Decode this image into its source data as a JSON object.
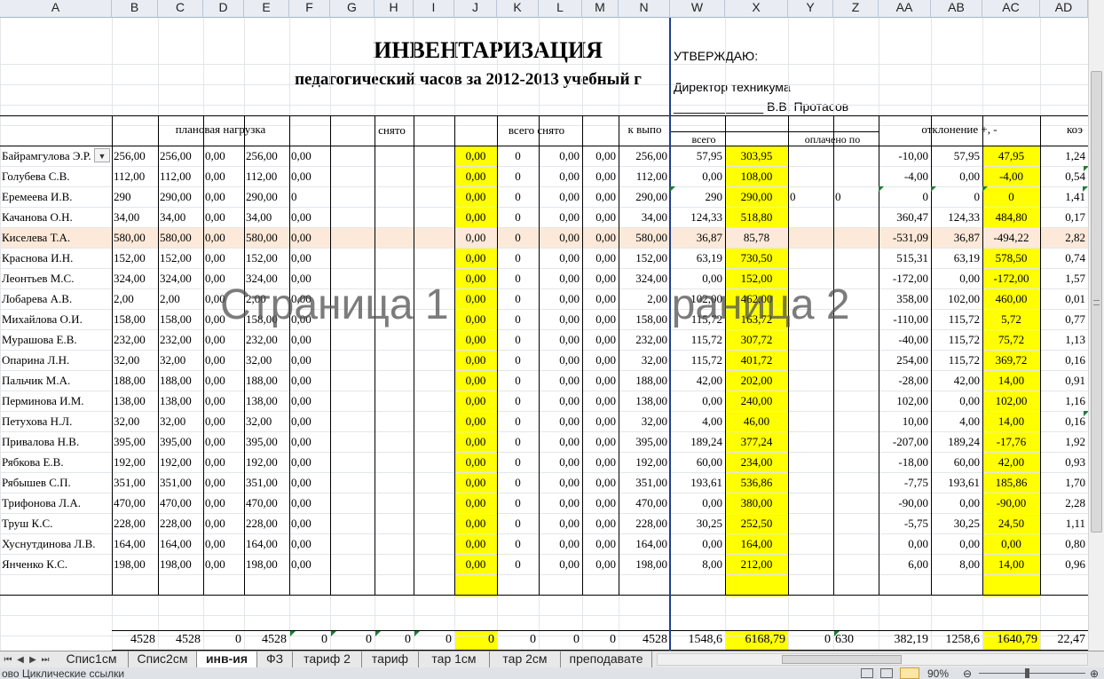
{
  "columns": [
    "A",
    "B",
    "C",
    "D",
    "E",
    "F",
    "G",
    "H",
    "I",
    "J",
    "K",
    "L",
    "M",
    "N",
    "W",
    "X",
    "Y",
    "Z",
    "AA",
    "AB",
    "AC",
    "AD"
  ],
  "title": "ИНВЕНТАРИЗАЦИЯ",
  "subtitle": "педагогический часов за 2012-2013 учебный г",
  "approval": {
    "approve": "УТВЕРЖДАЮ:",
    "director": "Директор техникума",
    "signature": "_____________ В.В. Протасов"
  },
  "headers": {
    "planned": "плановая нагрузка",
    "removed": "снято",
    "total_removed": "всего снято",
    "to_do": "к выпо",
    "total": "всего",
    "paid": "оплачено по",
    "deviation": "отклонение +, -",
    "coef": "коэ"
  },
  "rows": [
    [
      "Байрамгулова Э.Р.",
      "256,00",
      "256,00",
      "0,00",
      "256,00",
      "0,00",
      "0,00",
      "0",
      "0,00",
      "0,00",
      "256,00",
      "57,95",
      "303,95",
      "",
      "",
      "-10,00",
      "57,95",
      "47,95",
      "1,24"
    ],
    [
      "Голубева С.В.",
      "112,00",
      "112,00",
      "0,00",
      "112,00",
      "0,00",
      "0,00",
      "0",
      "0,00",
      "0,00",
      "112,00",
      "0,00",
      "108,00",
      "",
      "",
      "-4,00",
      "0,00",
      "-4,00",
      "0,54"
    ],
    [
      "Еремеева И.В.",
      "290",
      "290,00",
      "0,00",
      "290,00",
      "0",
      "0,00",
      "0",
      "0,00",
      "0,00",
      "290,00",
      "290",
      "290,00",
      "0",
      "0",
      "0",
      "0",
      "0",
      "1,41"
    ],
    [
      "Качанова О.Н.",
      "34,00",
      "34,00",
      "0,00",
      "34,00",
      "0,00",
      "0,00",
      "0",
      "0,00",
      "0,00",
      "34,00",
      "124,33",
      "518,80",
      "",
      "",
      "360,47",
      "124,33",
      "484,80",
      "0,17"
    ],
    [
      "Киселева Т.А.",
      "580,00",
      "580,00",
      "0,00",
      "580,00",
      "0,00",
      "0,00",
      "0",
      "0,00",
      "0,00",
      "580,00",
      "36,87",
      "85,78",
      "",
      "",
      "-531,09",
      "36,87",
      "-494,22",
      "2,82"
    ],
    [
      "Краснова И.Н.",
      "152,00",
      "152,00",
      "0,00",
      "152,00",
      "0,00",
      "0,00",
      "0",
      "0,00",
      "0,00",
      "152,00",
      "63,19",
      "730,50",
      "",
      "",
      "515,31",
      "63,19",
      "578,50",
      "0,74"
    ],
    [
      "Леонтьев М.С.",
      "324,00",
      "324,00",
      "0,00",
      "324,00",
      "0,00",
      "0,00",
      "0",
      "0,00",
      "0,00",
      "324,00",
      "0,00",
      "152,00",
      "",
      "",
      "-172,00",
      "0,00",
      "-172,00",
      "1,57"
    ],
    [
      "Лобарева А.В.",
      "2,00",
      "2,00",
      "0,00",
      "2,00",
      "0,00",
      "0,00",
      "0",
      "0,00",
      "0,00",
      "2,00",
      "102,00",
      "462,00",
      "",
      "",
      "358,00",
      "102,00",
      "460,00",
      "0,01"
    ],
    [
      "Михайлова О.И.",
      "158,00",
      "158,00",
      "0,00",
      "158,00",
      "0,00",
      "0,00",
      "0",
      "0,00",
      "0,00",
      "158,00",
      "115,72",
      "163,72",
      "",
      "",
      "-110,00",
      "115,72",
      "5,72",
      "0,77"
    ],
    [
      "Мурашова Е.В.",
      "232,00",
      "232,00",
      "0,00",
      "232,00",
      "0,00",
      "0,00",
      "0",
      "0,00",
      "0,00",
      "232,00",
      "115,72",
      "307,72",
      "",
      "",
      "-40,00",
      "115,72",
      "75,72",
      "1,13"
    ],
    [
      "Опарина Л.Н.",
      "32,00",
      "32,00",
      "0,00",
      "32,00",
      "0,00",
      "0,00",
      "0",
      "0,00",
      "0,00",
      "32,00",
      "115,72",
      "401,72",
      "",
      "",
      "254,00",
      "115,72",
      "369,72",
      "0,16"
    ],
    [
      "Пальчик М.А.",
      "188,00",
      "188,00",
      "0,00",
      "188,00",
      "0,00",
      "0,00",
      "0",
      "0,00",
      "0,00",
      "188,00",
      "42,00",
      "202,00",
      "",
      "",
      "-28,00",
      "42,00",
      "14,00",
      "0,91"
    ],
    [
      "Перминова И.М.",
      "138,00",
      "138,00",
      "0,00",
      "138,00",
      "0,00",
      "0,00",
      "0",
      "0,00",
      "0,00",
      "138,00",
      "0,00",
      "240,00",
      "",
      "",
      "102,00",
      "0,00",
      "102,00",
      "1,16"
    ],
    [
      "Петухова Н.Л.",
      "32,00",
      "32,00",
      "0,00",
      "32,00",
      "0,00",
      "0,00",
      "0",
      "0,00",
      "0,00",
      "32,00",
      "4,00",
      "46,00",
      "",
      "",
      "10,00",
      "4,00",
      "14,00",
      "0,16"
    ],
    [
      "Привалова Н.В.",
      "395,00",
      "395,00",
      "0,00",
      "395,00",
      "0,00",
      "0,00",
      "0",
      "0,00",
      "0,00",
      "395,00",
      "189,24",
      "377,24",
      "",
      "",
      "-207,00",
      "189,24",
      "-17,76",
      "1,92"
    ],
    [
      "Рябкова Е.В.",
      "192,00",
      "192,00",
      "0,00",
      "192,00",
      "0,00",
      "0,00",
      "0",
      "0,00",
      "0,00",
      "192,00",
      "60,00",
      "234,00",
      "",
      "",
      "-18,00",
      "60,00",
      "42,00",
      "0,93"
    ],
    [
      "Рябышев С.П.",
      "351,00",
      "351,00",
      "0,00",
      "351,00",
      "0,00",
      "0,00",
      "0",
      "0,00",
      "0,00",
      "351,00",
      "193,61",
      "536,86",
      "",
      "",
      "-7,75",
      "193,61",
      "185,86",
      "1,70"
    ],
    [
      "Трифонова Л.А.",
      "470,00",
      "470,00",
      "0,00",
      "470,00",
      "0,00",
      "0,00",
      "0",
      "0,00",
      "0,00",
      "470,00",
      "0,00",
      "380,00",
      "",
      "",
      "-90,00",
      "0,00",
      "-90,00",
      "2,28"
    ],
    [
      "Труш К.С.",
      "228,00",
      "228,00",
      "0,00",
      "228,00",
      "0,00",
      "0,00",
      "0",
      "0,00",
      "0,00",
      "228,00",
      "30,25",
      "252,50",
      "",
      "",
      "-5,75",
      "30,25",
      "24,50",
      "1,11"
    ],
    [
      "Хуснутдинова Л.В.",
      "164,00",
      "164,00",
      "0,00",
      "164,00",
      "0,00",
      "0,00",
      "0",
      "0,00",
      "0,00",
      "164,00",
      "0,00",
      "164,00",
      "",
      "",
      "0,00",
      "0,00",
      "0,00",
      "0,80"
    ],
    [
      "Янченко К.С.",
      "198,00",
      "198,00",
      "0,00",
      "198,00",
      "0,00",
      "0,00",
      "0",
      "0,00",
      "0,00",
      "198,00",
      "8,00",
      "212,00",
      "",
      "",
      "6,00",
      "8,00",
      "14,00",
      "0,96"
    ]
  ],
  "totals": [
    "4528",
    "4528",
    "0",
    "4528",
    "0",
    "0",
    "0",
    "0",
    "0",
    "0",
    "0",
    "0",
    "4528",
    "1548,6",
    "6168,79",
    "0",
    "630",
    "382,19",
    "1258,6",
    "1640,79",
    "22,47"
  ],
  "watermarks": [
    "Страница 1",
    "Страница 2"
  ],
  "tabs": [
    "Спис1см",
    "Спис2см",
    "инв-ия",
    "ФЗ",
    "тариф 2",
    "тариф",
    "тар 1см",
    "тар 2см",
    "преподавате"
  ],
  "active_tab": "инв-ия",
  "status": {
    "left": "ово    Циклические ссылки",
    "zoom": "90%"
  },
  "colors": {
    "highlight": "#ffff00",
    "selected_row": "#fde9d9",
    "page_break": "#1f3f8f"
  }
}
